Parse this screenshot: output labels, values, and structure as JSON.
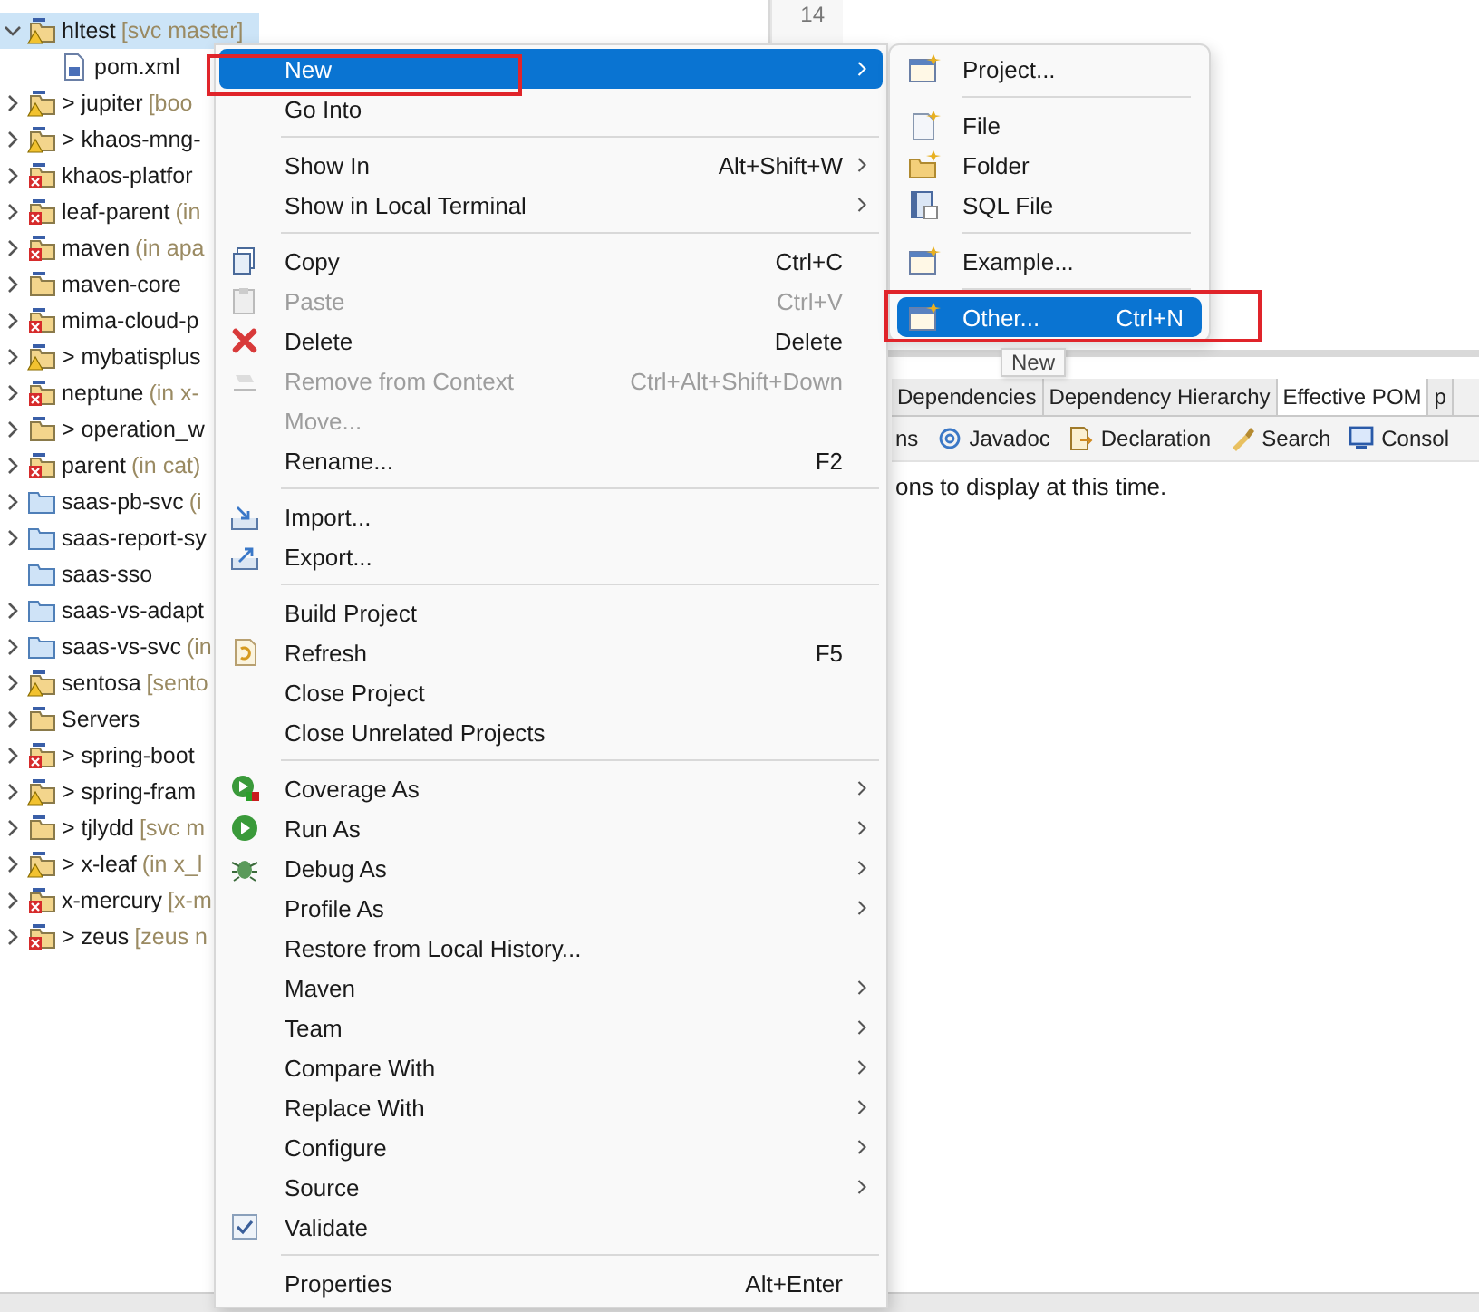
{
  "project_explorer": {
    "items": [
      {
        "label": "hltest",
        "decoration": "[svc master]",
        "kind": "warned",
        "expandable": true,
        "expanded": true,
        "selected": true,
        "children": [
          {
            "label": "pom.xml",
            "kind": "file",
            "expandable": false,
            "selected": false
          }
        ]
      },
      {
        "label": "> jupiter",
        "decoration": "[boo",
        "kind": "warned",
        "expandable": true,
        "expanded": false,
        "selected": false
      },
      {
        "label": "> khaos-mng-",
        "kind": "warned",
        "expandable": true,
        "expanded": false,
        "selected": false
      },
      {
        "label": "khaos-platfor",
        "kind": "broken",
        "expandable": true,
        "expanded": false,
        "selected": false
      },
      {
        "label": "leaf-parent",
        "decoration": "(in",
        "kind": "broken",
        "expandable": true,
        "expanded": false,
        "selected": false
      },
      {
        "label": "maven",
        "decoration": "(in apa",
        "kind": "broken",
        "expandable": true,
        "expanded": false,
        "selected": false
      },
      {
        "label": "maven-core",
        "kind": "project",
        "expandable": true,
        "expanded": false,
        "selected": false
      },
      {
        "label": "mima-cloud-p",
        "kind": "broken",
        "expandable": true,
        "expanded": false,
        "selected": false
      },
      {
        "label": "> mybatisplus",
        "kind": "warned",
        "expandable": true,
        "expanded": false,
        "selected": false
      },
      {
        "label": "neptune",
        "decoration": "(in x-",
        "kind": "broken",
        "expandable": true,
        "expanded": false,
        "selected": false
      },
      {
        "label": "> operation_w",
        "kind": "project",
        "expandable": true,
        "expanded": false,
        "selected": false
      },
      {
        "label": "parent",
        "decoration": "(in cat)",
        "kind": "broken",
        "expandable": true,
        "expanded": false,
        "selected": false
      },
      {
        "label": "saas-pb-svc",
        "decoration": "(i",
        "kind": "folder",
        "expandable": true,
        "expanded": false,
        "selected": false
      },
      {
        "label": "saas-report-sy",
        "kind": "folder",
        "expandable": true,
        "expanded": false,
        "selected": false
      },
      {
        "label": "saas-sso",
        "kind": "folder",
        "expandable": false,
        "selected": false
      },
      {
        "label": "saas-vs-adapt",
        "kind": "folder",
        "expandable": true,
        "expanded": false,
        "selected": false
      },
      {
        "label": "saas-vs-svc",
        "decoration": "(in",
        "kind": "folder",
        "expandable": true,
        "expanded": false,
        "selected": false
      },
      {
        "label": "sentosa",
        "decoration": "[sento",
        "kind": "warned",
        "expandable": true,
        "expanded": false,
        "selected": false
      },
      {
        "label": "Servers",
        "kind": "project",
        "expandable": true,
        "expanded": false,
        "selected": false
      },
      {
        "label": "> spring-boot",
        "kind": "broken",
        "expandable": true,
        "expanded": false,
        "selected": false
      },
      {
        "label": "> spring-fram",
        "kind": "warned",
        "expandable": true,
        "expanded": false,
        "selected": false
      },
      {
        "label": "> tjlydd",
        "decoration": "[svc m",
        "kind": "project",
        "expandable": true,
        "expanded": false,
        "selected": false
      },
      {
        "label": "> x-leaf",
        "decoration": "(in x_l",
        "kind": "warned",
        "expandable": true,
        "expanded": false,
        "selected": false
      },
      {
        "label": "x-mercury",
        "decoration": "[x-m",
        "kind": "broken",
        "expandable": true,
        "expanded": false,
        "selected": false
      },
      {
        "label": "> zeus",
        "decoration": "[zeus n",
        "kind": "broken",
        "expandable": true,
        "expanded": false,
        "selected": false
      }
    ]
  },
  "editor": {
    "line_numbers": [
      "14"
    ]
  },
  "context_menu": {
    "items": [
      {
        "kind": "item",
        "label": "New",
        "submenu": true,
        "disabled": false,
        "selected": true,
        "outlined": true
      },
      {
        "kind": "item",
        "label": "Go Into",
        "submenu": false,
        "disabled": false,
        "selected": false,
        "outlined": false
      },
      {
        "kind": "separator"
      },
      {
        "kind": "item",
        "label": "Show In",
        "shortcut": "Alt+Shift+W",
        "submenu": true,
        "disabled": false,
        "selected": false,
        "outlined": false
      },
      {
        "kind": "item",
        "label": "Show in Local Terminal",
        "submenu": true,
        "disabled": false,
        "selected": false,
        "outlined": false
      },
      {
        "kind": "separator"
      },
      {
        "kind": "item",
        "label": "Copy",
        "shortcut": "Ctrl+C",
        "submenu": false,
        "disabled": false,
        "selected": false,
        "outlined": false
      },
      {
        "kind": "item",
        "label": "Paste",
        "shortcut": "Ctrl+V",
        "submenu": false,
        "disabled": true,
        "selected": false,
        "outlined": false
      },
      {
        "kind": "item",
        "label": "Delete",
        "shortcut": "Delete",
        "submenu": false,
        "disabled": false,
        "selected": false,
        "outlined": false
      },
      {
        "kind": "item",
        "label": "Remove from Context",
        "shortcut": "Ctrl+Alt+Shift+Down",
        "submenu": false,
        "disabled": true,
        "selected": false,
        "outlined": false
      },
      {
        "kind": "item",
        "label": "Move...",
        "submenu": false,
        "disabled": true,
        "selected": false,
        "outlined": false
      },
      {
        "kind": "item",
        "label": "Rename...",
        "shortcut": "F2",
        "submenu": false,
        "disabled": false,
        "selected": false,
        "outlined": false
      },
      {
        "kind": "separator"
      },
      {
        "kind": "item",
        "label": "Import...",
        "submenu": false,
        "disabled": false,
        "selected": false,
        "outlined": false
      },
      {
        "kind": "item",
        "label": "Export...",
        "submenu": false,
        "disabled": false,
        "selected": false,
        "outlined": false
      },
      {
        "kind": "separator"
      },
      {
        "kind": "item",
        "label": "Build Project",
        "submenu": false,
        "disabled": false,
        "selected": false,
        "outlined": false
      },
      {
        "kind": "item",
        "label": "Refresh",
        "shortcut": "F5",
        "submenu": false,
        "disabled": false,
        "selected": false,
        "outlined": false
      },
      {
        "kind": "item",
        "label": "Close Project",
        "submenu": false,
        "disabled": false,
        "selected": false,
        "outlined": false
      },
      {
        "kind": "item",
        "label": "Close Unrelated Projects",
        "submenu": false,
        "disabled": false,
        "selected": false,
        "outlined": false
      },
      {
        "kind": "separator"
      },
      {
        "kind": "item",
        "label": "Coverage As",
        "submenu": true,
        "disabled": false,
        "selected": false,
        "outlined": false
      },
      {
        "kind": "item",
        "label": "Run As",
        "submenu": true,
        "disabled": false,
        "selected": false,
        "outlined": false
      },
      {
        "kind": "item",
        "label": "Debug As",
        "submenu": true,
        "disabled": false,
        "selected": false,
        "outlined": false
      },
      {
        "kind": "item",
        "label": "Profile As",
        "submenu": true,
        "disabled": false,
        "selected": false,
        "outlined": false
      },
      {
        "kind": "item",
        "label": "Restore from Local History...",
        "submenu": false,
        "disabled": false,
        "selected": false,
        "outlined": false
      },
      {
        "kind": "item",
        "label": "Maven",
        "submenu": true,
        "disabled": false,
        "selected": false,
        "outlined": false
      },
      {
        "kind": "item",
        "label": "Team",
        "submenu": true,
        "disabled": false,
        "selected": false,
        "outlined": false
      },
      {
        "kind": "item",
        "label": "Compare With",
        "submenu": true,
        "disabled": false,
        "selected": false,
        "outlined": false
      },
      {
        "kind": "item",
        "label": "Replace With",
        "submenu": true,
        "disabled": false,
        "selected": false,
        "outlined": false
      },
      {
        "kind": "item",
        "label": "Configure",
        "submenu": true,
        "disabled": false,
        "selected": false,
        "outlined": false
      },
      {
        "kind": "item",
        "label": "Source",
        "submenu": true,
        "disabled": false,
        "selected": false,
        "outlined": false
      },
      {
        "kind": "item",
        "label": "Validate",
        "submenu": false,
        "disabled": false,
        "selected": false,
        "outlined": false
      },
      {
        "kind": "separator"
      },
      {
        "kind": "item",
        "label": "Properties",
        "shortcut": "Alt+Enter",
        "submenu": false,
        "disabled": false,
        "selected": false,
        "outlined": false
      }
    ]
  },
  "new_submenu": {
    "items": [
      {
        "kind": "item",
        "label": "Project...",
        "selected": false,
        "outlined": false
      },
      {
        "kind": "separator"
      },
      {
        "kind": "item",
        "label": "File",
        "selected": false,
        "outlined": false
      },
      {
        "kind": "item",
        "label": "Folder",
        "selected": false,
        "outlined": false
      },
      {
        "kind": "item",
        "label": "SQL File",
        "selected": false,
        "outlined": false
      },
      {
        "kind": "separator"
      },
      {
        "kind": "item",
        "label": "Example...",
        "selected": false,
        "outlined": false
      },
      {
        "kind": "separator"
      },
      {
        "kind": "item",
        "label": "Other...",
        "shortcut": "Ctrl+N",
        "selected": true,
        "outlined": true
      }
    ]
  },
  "tooltip": {
    "text": "New"
  },
  "bottom_panel": {
    "tabs": [
      {
        "label": "Dependencies",
        "selected": false
      },
      {
        "label": "Dependency Hierarchy",
        "selected": false
      },
      {
        "label": "Effective POM",
        "selected": true
      },
      {
        "label": "p",
        "selected": false
      }
    ],
    "views": [
      {
        "label": "ns"
      },
      {
        "label": "Javadoc"
      },
      {
        "label": "Declaration"
      },
      {
        "label": "Search"
      },
      {
        "label": "Consol"
      }
    ],
    "message": "ons to display at this time."
  }
}
